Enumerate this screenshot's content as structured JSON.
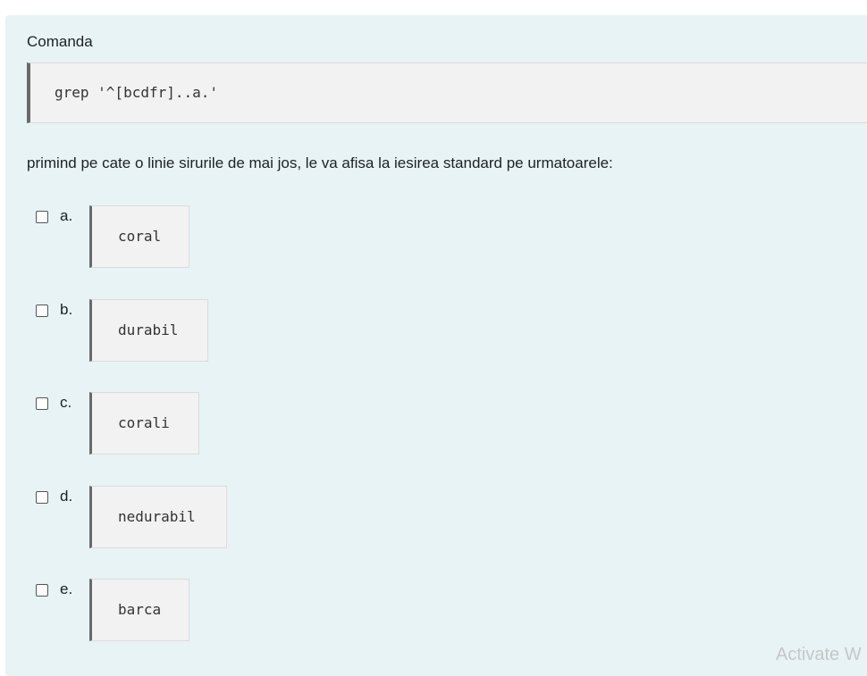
{
  "question": {
    "intro": "Comanda",
    "command": "grep '^[bcdfr]..a.'",
    "prompt": "primind pe cate o linie sirurile de mai jos, le va afisa la iesirea standard pe urmatoarele:",
    "options": [
      {
        "letter": "a.",
        "value": "coral"
      },
      {
        "letter": "b.",
        "value": "durabil"
      },
      {
        "letter": "c.",
        "value": "corali"
      },
      {
        "letter": "d.",
        "value": "nedurabil"
      },
      {
        "letter": "e.",
        "value": "barca"
      }
    ]
  },
  "watermark": "Activate W"
}
